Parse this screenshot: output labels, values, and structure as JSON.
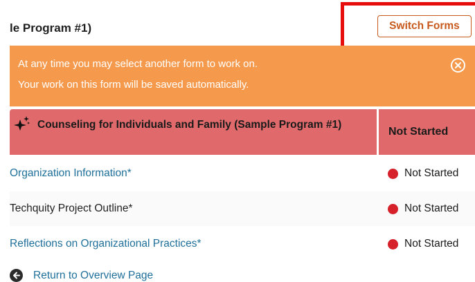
{
  "header": {
    "title": "le Program #1)",
    "switch_label": "Switch Forms"
  },
  "banner": {
    "line1": "At any time you may select another form to work on.",
    "line2": "Your work on this form will be saved automatically.",
    "close_icon": "circle-x-icon",
    "color": "#f59a4d"
  },
  "table": {
    "header_title": "Counseling for Individuals and Family (Sample Program #1)",
    "header_status": "Not Started",
    "header_icon": "sparkle-icon",
    "header_color": "#e06a6b",
    "rows": [
      {
        "label": "Organization Information*",
        "status": "Not Started",
        "is_link": true
      },
      {
        "label": "Techquity Project Outline*",
        "status": "Not Started",
        "is_link": false
      },
      {
        "label": "Reflections on Organizational Practices*",
        "status": "Not Started",
        "is_link": true
      }
    ],
    "status_dot_color": "#d6202a"
  },
  "footer": {
    "return_label": "Return to Overview Page",
    "return_icon": "arrow-left-circle-icon"
  },
  "annotation": {
    "highlight_color": "#e80d0d"
  }
}
